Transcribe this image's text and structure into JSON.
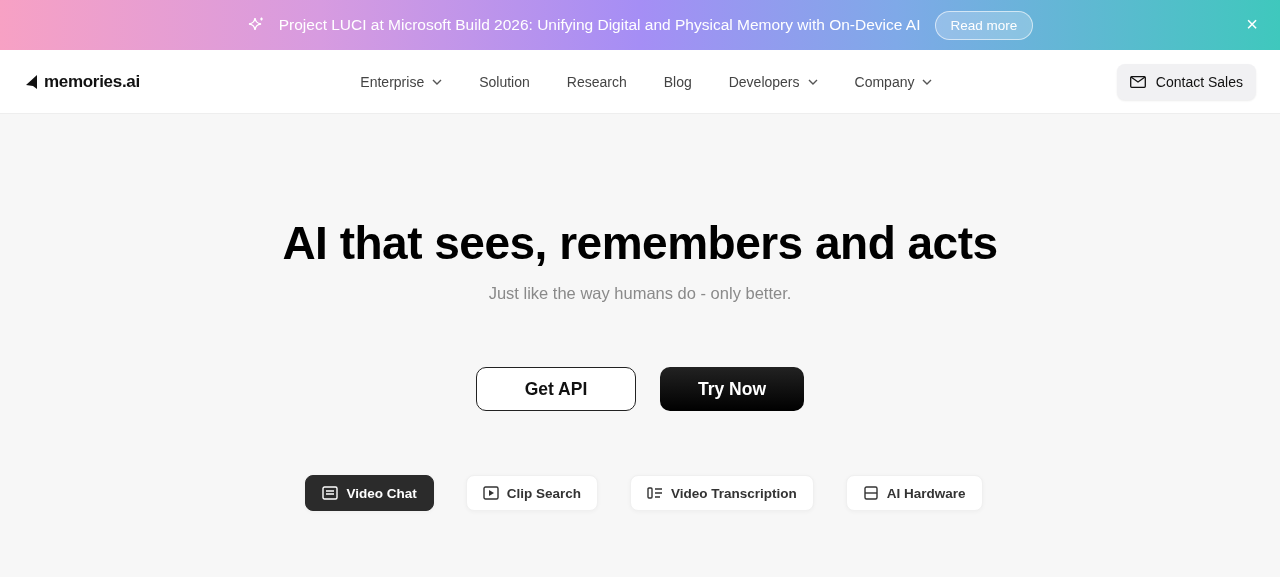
{
  "announcement": {
    "text": "Project LUCI at Microsoft Build 2026: Unifying Digital and Physical Memory with On-Device AI",
    "link": "Read more",
    "close": "×"
  },
  "header": {
    "logo": "memories.ai",
    "nav": [
      {
        "label": "Enterprise",
        "dropdown": true
      },
      {
        "label": "Solution",
        "dropdown": false
      },
      {
        "label": "Research",
        "dropdown": false
      },
      {
        "label": "Blog",
        "dropdown": false
      },
      {
        "label": "Developers",
        "dropdown": true
      },
      {
        "label": "Company",
        "dropdown": true
      }
    ],
    "cta": "Contact Sales"
  },
  "hero": {
    "title": "AI that sees, remembers and acts",
    "subtitle": "Just like the way humans do - only better.",
    "buttons": [
      {
        "label": "Get API",
        "kind": "outline"
      },
      {
        "label": "Try Now",
        "kind": "solid"
      }
    ]
  },
  "feature_tabs": [
    {
      "label": "Video Chat",
      "selected": true,
      "kind": "chat"
    },
    {
      "label": "Clip Search",
      "selected": false,
      "kind": "play"
    },
    {
      "label": "Video Transcription",
      "selected": false,
      "kind": "list"
    },
    {
      "label": "AI Hardware",
      "selected": false,
      "kind": "device"
    }
  ]
}
